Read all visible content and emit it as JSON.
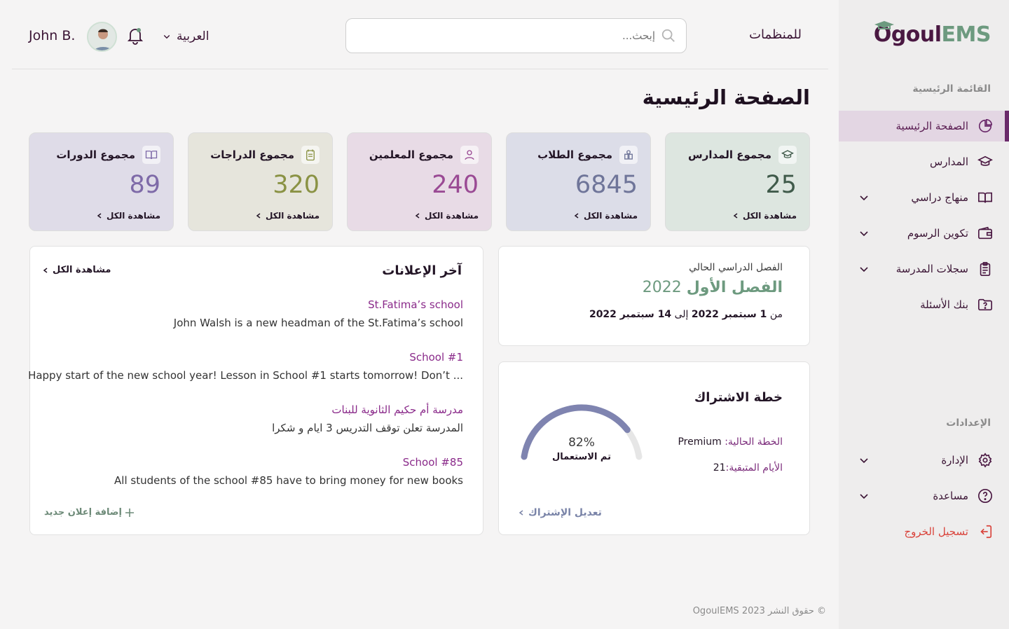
{
  "sidebar": {
    "logo": {
      "part1": "Ogoul",
      "part2": "EMS"
    },
    "main_menu_title": "القائمة الرئيسية",
    "items": [
      {
        "label": "الصفحة الرئيسية",
        "icon": "pie-chart-icon",
        "active": true
      },
      {
        "label": "المدارس",
        "icon": "graduation-cap-icon"
      },
      {
        "label": "منهاج دراسي",
        "icon": "book-icon",
        "expandable": true
      },
      {
        "label": "تكوين الرسوم",
        "icon": "wallet-icon",
        "expandable": true
      },
      {
        "label": "سجلات المدرسة",
        "icon": "clipboard-icon",
        "expandable": true
      },
      {
        "label": "بنك الأسئلة",
        "icon": "question-folder-icon"
      }
    ],
    "settings_title": "الإعدادات",
    "settings_items": [
      {
        "label": "الإدارة",
        "icon": "gear-icon",
        "expandable": true
      },
      {
        "label": "مساعدة",
        "icon": "help-circle-icon",
        "expandable": true
      },
      {
        "label": "تسجيل الخروج",
        "icon": "logout-icon"
      }
    ]
  },
  "header": {
    "org_link": "للمنظمات",
    "search_placeholder": "إبحث...",
    "language": "العربية",
    "user_name": "John B."
  },
  "page_title": "الصفحة الرئيسية",
  "stats": [
    {
      "title": "مجموع المدارس",
      "value": "25",
      "more": "مشاهدة الكل",
      "icon": "graduation-cap-icon",
      "bg": "#dde6e0",
      "color": "#3f5a4a"
    },
    {
      "title": "مجموع الطلاب",
      "value": "6845",
      "more": "مشاهدة الكل",
      "icon": "users-icon",
      "bg": "#dcdde8",
      "color": "#6f7599"
    },
    {
      "title": "مجموع المعلمين",
      "value": "240",
      "more": "مشاهدة الكل",
      "icon": "user-icon",
      "bg": "#e8dbe6",
      "color": "#9a4a94"
    },
    {
      "title": "مجموع الدراجات",
      "value": "320",
      "more": "مشاهدة الكل",
      "icon": "clipboard-icon",
      "bg": "#e6e5dc",
      "color": "#8a9244"
    },
    {
      "title": "مجموع الدورات",
      "value": "89",
      "more": "مشاهدة الكل",
      "icon": "book-icon",
      "bg": "#dfdce8",
      "color": "#7e6aa8"
    }
  ],
  "term": {
    "label": "الفصل الدراسي الحالي",
    "name": "الفصل الأول",
    "year": "2022",
    "range_prefix": "من",
    "start": "1 سبتمبر 2022",
    "to": "إلى",
    "end": "14 سبتمبر 2022"
  },
  "subscription": {
    "title": "خطة الاشتراك",
    "plan_label": "الخطة الحالية:",
    "plan_value": "Premium",
    "days_label": "الأيام المتبقية:",
    "days_value": "21",
    "used_percent_text": "82%",
    "used_fraction": 0.82,
    "used_label": "تم الاستعمال",
    "edit_label": "تعديل الإشتراك"
  },
  "announcements": {
    "title": "آخر الإعلانات",
    "more": "مشاهدة الكل",
    "items": [
      {
        "school": "St.Fatima’s school",
        "message": "John Walsh is a new headman of the St.Fatima’s school"
      },
      {
        "school": "School #1",
        "message": "Happy start of the new school year! Lesson in School #1 starts tomorrow! Don’t ..."
      },
      {
        "school": "مدرسة أم حكيم الثانوية للبنات",
        "message": "المدرسة تعلن توقف التدريس 3 ايام و شكرا"
      },
      {
        "school": "School #85",
        "message": "All students of the school #85 have to bring money for new books"
      }
    ],
    "add_label": "إضافة إعلان جديد"
  },
  "footer": {
    "copyright": "© حقوق النشر 2023 OgoulEMS"
  }
}
